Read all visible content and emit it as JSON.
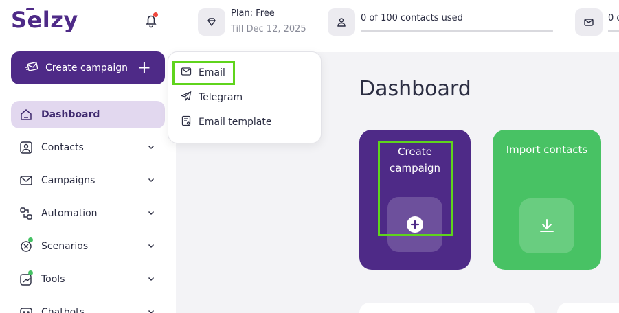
{
  "brand": {
    "logo_text": "Selzy"
  },
  "header": {
    "plan_title": "Plan: Free",
    "plan_until": "Till Dec 12, 2025",
    "contacts_used": "0 of 100 contacts used",
    "contacts_progress": 0,
    "emails_used_partial": "0 c",
    "notification_badge_color": "#f0483e"
  },
  "sidebar": {
    "create_campaign_label": "Create campaign",
    "create_campaign_plus": "+",
    "items": [
      {
        "label": "Dashboard",
        "icon": "home-icon",
        "active": true,
        "has_chevron": false,
        "badge": false
      },
      {
        "label": "Contacts",
        "icon": "contacts-icon",
        "active": false,
        "has_chevron": true,
        "badge": false
      },
      {
        "label": "Campaigns",
        "icon": "envelope-icon",
        "active": false,
        "has_chevron": true,
        "badge": false
      },
      {
        "label": "Automation",
        "icon": "automation-icon",
        "active": false,
        "has_chevron": true,
        "badge": false
      },
      {
        "label": "Scenarios",
        "icon": "scenarios-icon",
        "active": false,
        "has_chevron": true,
        "badge": true
      },
      {
        "label": "Tools",
        "icon": "tools-icon",
        "active": false,
        "has_chevron": true,
        "badge": true
      },
      {
        "label": "Chatbots",
        "icon": "chatbot-icon",
        "active": false,
        "has_chevron": true,
        "badge": false
      }
    ]
  },
  "dropdown": {
    "items": [
      {
        "label": "Email",
        "icon": "envelope-icon",
        "highlighted": true
      },
      {
        "label": "Telegram",
        "icon": "telegram-icon",
        "highlighted": false
      },
      {
        "label": "Email template",
        "icon": "template-icon",
        "highlighted": false
      }
    ]
  },
  "main": {
    "title": "Dashboard",
    "cards": [
      {
        "title_line1": "Create",
        "title_line2": "campaign",
        "icon": "plus-circle-icon",
        "color": "#4e2a87"
      },
      {
        "title": "Import contacts",
        "icon": "download-icon",
        "color": "#48c264"
      }
    ]
  },
  "colors": {
    "brand_purple": "#4e2a87",
    "active_nav_bg": "#e2d8ef",
    "green": "#48c264",
    "highlight": "#5fd41c",
    "badge_green": "#45c164"
  }
}
